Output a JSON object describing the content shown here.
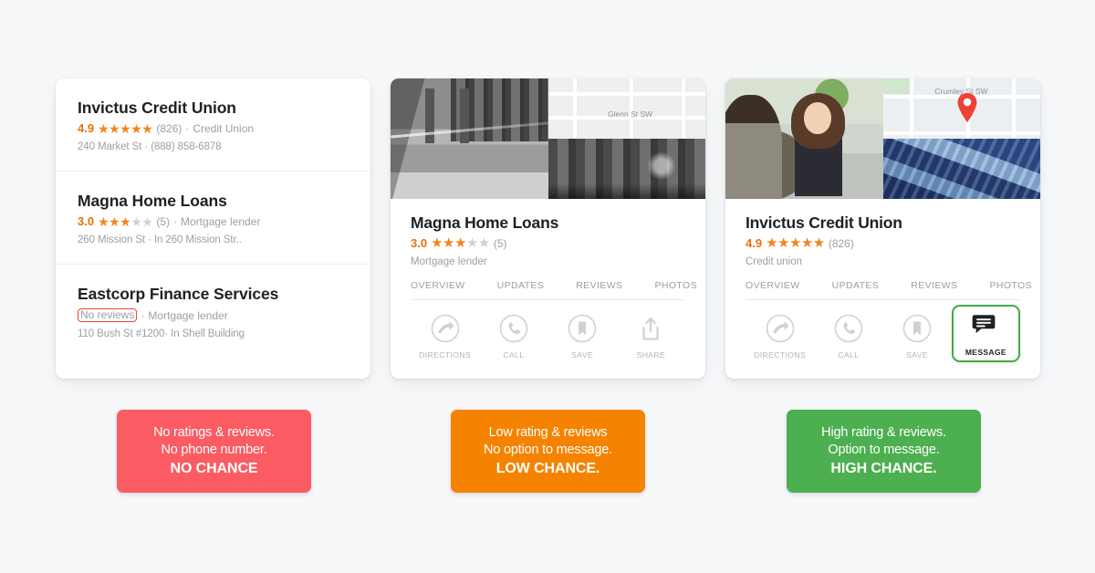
{
  "page": {
    "background_color": "#f7f8fa"
  },
  "colors": {
    "star_on": "#f3841c",
    "star_off": "#cfd2d5",
    "rating_text": "#e8710a",
    "highlight_red": "#f4403a",
    "highlight_green": "#3fab48",
    "banner_red": "#fb5b63",
    "banner_orange": "#f58300",
    "banner_green": "#4caf50",
    "map_pin": "#ea4335"
  },
  "results_list": {
    "items": [
      {
        "name": "Invictus Credit Union",
        "rating": "4.9",
        "stars_filled": 5,
        "reviews": "(826)",
        "separator": "·",
        "category": "Credit Union",
        "detail": "240 Market St · (888) 858-6878",
        "no_reviews": false
      },
      {
        "name": "Magna Home Loans",
        "rating": "3.0",
        "stars_filled": 3,
        "reviews": "(5)",
        "separator": "·",
        "category": "Mortgage lender",
        "detail": "260 Mission St · In 260 Mission Str..",
        "no_reviews": false
      },
      {
        "name": "Eastcorp Finance Services",
        "rating": "",
        "stars_filled": 0,
        "reviews": "",
        "separator": "·",
        "category": "Mortgage lender",
        "detail": "110 Bush St #1200· In Shell Building",
        "no_reviews": true,
        "no_reviews_label": "No reviews"
      }
    ]
  },
  "profile_cards": [
    {
      "id": "magna",
      "name": "Magna Home Loans",
      "rating": "3.0",
      "stars_filled": 3,
      "reviews": "(5)",
      "category": "Mortgage lender",
      "map_label": "Glenn St SW",
      "has_pin": false,
      "photos_grayscale": true,
      "tabs": [
        "OVERVIEW",
        "UPDATES",
        "REVIEWS",
        "PHOTOS"
      ],
      "actions": [
        {
          "icon": "directions-icon",
          "label": "DIRECTIONS",
          "highlighted": false
        },
        {
          "icon": "call-icon",
          "label": "CALL",
          "highlighted": false
        },
        {
          "icon": "save-icon",
          "label": "SAVE",
          "highlighted": false
        },
        {
          "icon": "share-icon",
          "label": "SHARE",
          "highlighted": false
        }
      ]
    },
    {
      "id": "invictus",
      "name": "Invictus Credit Union",
      "rating": "4.9",
      "stars_filled": 5,
      "reviews": "(826)",
      "category": "Credit union",
      "map_label": "Crumley St SW",
      "has_pin": true,
      "photos_grayscale": false,
      "tabs": [
        "OVERVIEW",
        "UPDATES",
        "REVIEWS",
        "PHOTOS"
      ],
      "actions": [
        {
          "icon": "directions-icon",
          "label": "DIRECTIONS",
          "highlighted": false
        },
        {
          "icon": "call-icon",
          "label": "CALL",
          "highlighted": false
        },
        {
          "icon": "save-icon",
          "label": "SAVE",
          "highlighted": false
        },
        {
          "icon": "message-icon",
          "label": "MESSAGE",
          "highlighted": true
        }
      ]
    }
  ],
  "banners": [
    {
      "id": "red",
      "line1": "No ratings & reviews.",
      "line2": "No phone number.",
      "line3": "NO CHANCE",
      "color": "#fb5b63"
    },
    {
      "id": "orange",
      "line1": "Low rating & reviews",
      "line2": "No option to message.",
      "line3": "LOW CHANCE.",
      "color": "#f58300"
    },
    {
      "id": "green",
      "line1": "High rating & reviews.",
      "line2": "Option to message.",
      "line3": "HIGH CHANCE.",
      "color": "#4caf50"
    }
  ]
}
